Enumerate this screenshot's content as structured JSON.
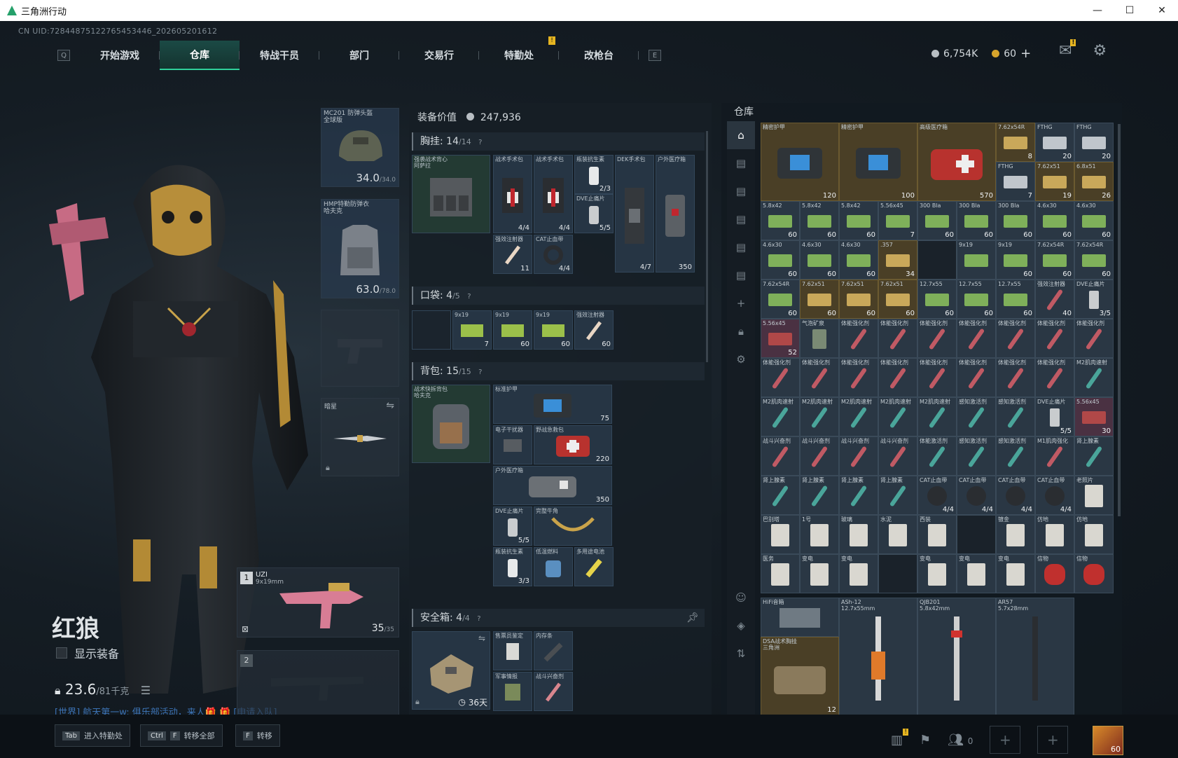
{
  "window": {
    "title": "三角洲行动",
    "minimize": "—",
    "maximize": "☐",
    "close": "✕"
  },
  "uid": "CN UID:72844875122765453446_202605201612",
  "nav": {
    "key_left": "Q",
    "key_right": "E",
    "tabs": [
      "开始游戏",
      "仓库",
      "特战干员",
      "部门",
      "交易行",
      "特勤处",
      "改枪台"
    ],
    "active": "仓库",
    "badge": "!"
  },
  "currency": {
    "silver": "6,754K",
    "gold": "60",
    "add": "+",
    "mail_badge": "!"
  },
  "operator": {
    "name": "红狼",
    "show_equipment": "显示装备",
    "weight": "23.6",
    "weight_max": "/81千克"
  },
  "chat": "[世界] 航天第一w: 俱乐部活动，来人🎁 🎁 [申请入队]",
  "slots": {
    "helmet": {
      "label": "MC201 防弹头盔\n全球版",
      "value": "34.0",
      "max": "/34.0"
    },
    "armor": {
      "label": "HMP特勤防弹衣\n哈夫克",
      "value": "63.0",
      "max": "/78.0"
    },
    "melee": {
      "label": "暗星",
      "swap": "⇋"
    },
    "weapon1": {
      "index": "1",
      "name": "UZI",
      "caliber": "9x19mm",
      "ammo": "35",
      "ammo_max": "/35"
    },
    "weapon2": {
      "index": "2"
    }
  },
  "equip": {
    "title": "装备价值",
    "value": "247,936",
    "chest": {
      "label": "胸挂:",
      "count": "14",
      "max": "/14",
      "help": "?"
    },
    "pocket": {
      "label": "口袋:",
      "count": "4",
      "max": "/5",
      "help": "?"
    },
    "backpack": {
      "label": "背包:",
      "count": "15",
      "max": "/15",
      "help": "?"
    },
    "safebox": {
      "label": "安全箱:",
      "count": "4",
      "max": "/4",
      "help": "?",
      "days": "36天"
    },
    "chest_items": [
      {
        "label": "强袭战术背心\n阿萨拉",
        "count": ""
      },
      {
        "label": "战术手术包",
        "count": "4/4"
      },
      {
        "label": "战术手术包",
        "count": "4/4"
      },
      {
        "label": "瓶装抗生素",
        "count": "2/3"
      },
      {
        "label": "DVE止痛片",
        "count": "5/5"
      },
      {
        "label": "DEK手术包",
        "count": "4/7"
      },
      {
        "label": "户外医疗箱",
        "count": "350"
      },
      {
        "label": "强效注射器",
        "count": "11"
      },
      {
        "label": "CAT止血带",
        "count": "4/4"
      }
    ],
    "pocket_items": [
      {
        "label": "9x19",
        "count": "7"
      },
      {
        "label": "9x19",
        "count": "60"
      },
      {
        "label": "9x19",
        "count": "60"
      },
      {
        "label": "强效注射器",
        "count": "60"
      }
    ],
    "backpack_items": [
      {
        "label": "战术快拆背包\n哈夫克",
        "count": ""
      },
      {
        "label": "标准护甲",
        "count": "75"
      },
      {
        "label": "电子干扰器",
        "count": ""
      },
      {
        "label": "野战急救包",
        "count": "220"
      },
      {
        "label": "户外医疗箱",
        "count": "350"
      },
      {
        "label": "DVE止痛片",
        "count": "5/5"
      },
      {
        "label": "完整牛角",
        "count": ""
      },
      {
        "label": "瓶装抗生素",
        "count": "3/3"
      },
      {
        "label": "低温燃料",
        "count": ""
      },
      {
        "label": "多用途电池",
        "count": ""
      }
    ],
    "safebox_items": [
      {
        "label": "售票员鉴定",
        "count": ""
      },
      {
        "label": "内存条",
        "count": ""
      },
      {
        "label": "军事情报",
        "count": ""
      },
      {
        "label": "战斗兴奋剂",
        "count": ""
      }
    ]
  },
  "warehouse": {
    "title": "仓库",
    "big_items": [
      {
        "label": "精密护甲",
        "count": "120"
      },
      {
        "label": "精密护甲",
        "count": "100"
      },
      {
        "label": "高级医疗箱",
        "count": "570"
      },
      {
        "label": "DSA战术胸挂\n三角洲",
        "count": "12"
      },
      {
        "label": "HiFi音箱",
        "count": ""
      },
      {
        "label": "ASh-12\n12.7x55mm",
        "count": ""
      },
      {
        "label": "QJB201\n5.8x42mm",
        "count": ""
      },
      {
        "label": "AR57\n5.7x28mm",
        "count": ""
      }
    ],
    "grid": [
      [
        null,
        null,
        null,
        null,
        null,
        null,
        {
          "l": "7.62x54R",
          "n": "8",
          "t": "gold"
        },
        {
          "l": "FTHG",
          "n": "20"
        },
        {
          "l": "FTHG",
          "n": "20"
        }
      ],
      [
        null,
        null,
        null,
        null,
        null,
        null,
        {
          "l": "FTHG",
          "n": "7"
        },
        {
          "l": "7.62x51",
          "n": "19",
          "t": "gold"
        },
        {
          "l": "6.8x51",
          "n": "26",
          "t": "gold"
        }
      ],
      [
        {
          "l": "5.8x42",
          "n": "60"
        },
        {
          "l": "5.8x42",
          "n": "60"
        },
        {
          "l": "5.8x42",
          "n": "60"
        },
        {
          "l": "5.56x45",
          "n": "7"
        },
        {
          "l": "300 Bla",
          "n": "60"
        },
        {
          "l": "300 Bla",
          "n": "60"
        },
        {
          "l": "300 Bla",
          "n": "60"
        },
        {
          "l": "4.6x30",
          "n": "60"
        },
        {
          "l": "4.6x30",
          "n": "60"
        }
      ],
      [
        {
          "l": "4.6x30",
          "n": "60"
        },
        {
          "l": "4.6x30",
          "n": "60"
        },
        {
          "l": "4.6x30",
          "n": "60"
        },
        {
          "l": ".357",
          "n": "34",
          "t": "gold"
        },
        {
          "l": "",
          "n": "",
          "t": "empty"
        },
        {
          "l": "9x19",
          "n": ""
        },
        {
          "l": "9x19",
          "n": "60"
        },
        {
          "l": "7.62x54R",
          "n": "60"
        },
        {
          "l": "7.62x54R",
          "n": "60"
        }
      ],
      [
        {
          "l": "7.62x54R",
          "n": "60"
        },
        {
          "l": "7.62x51",
          "n": "60",
          "t": "gold"
        },
        {
          "l": "7.62x51",
          "n": "60",
          "t": "gold"
        },
        {
          "l": "7.62x51",
          "n": "60",
          "t": "gold"
        },
        {
          "l": "12.7x55",
          "n": "60"
        },
        {
          "l": "12.7x55",
          "n": "60"
        },
        {
          "l": "12.7x55",
          "n": "60"
        },
        {
          "l": "强效注射器",
          "n": "40"
        },
        {
          "l": "DVE止痛片",
          "n": "3/5"
        }
      ],
      [
        {
          "l": "5.56x45",
          "n": "52",
          "t": "pink"
        },
        {
          "l": "气泡矿泉",
          "n": ""
        },
        {
          "l": "体能强化剂",
          "n": ""
        },
        {
          "l": "体能强化剂",
          "n": ""
        },
        {
          "l": "体能强化剂",
          "n": ""
        },
        {
          "l": "体能强化剂",
          "n": ""
        },
        {
          "l": "体能强化剂",
          "n": ""
        },
        {
          "l": "体能强化剂",
          "n": ""
        },
        {
          "l": "体能强化剂",
          "n": ""
        }
      ],
      [
        {
          "l": "体能强化剂",
          "n": ""
        },
        {
          "l": "体能强化剂",
          "n": ""
        },
        {
          "l": "体能强化剂",
          "n": ""
        },
        {
          "l": "体能强化剂",
          "n": ""
        },
        {
          "l": "体能强化剂",
          "n": ""
        },
        {
          "l": "体能强化剂",
          "n": ""
        },
        {
          "l": "体能强化剂",
          "n": ""
        },
        {
          "l": "体能强化剂",
          "n": ""
        },
        {
          "l": "M2肌肉速射",
          "n": ""
        }
      ],
      [
        {
          "l": "M2肌肉速射",
          "n": ""
        },
        {
          "l": "M2肌肉速射",
          "n": ""
        },
        {
          "l": "M2肌肉速射",
          "n": ""
        },
        {
          "l": "M2肌肉速射",
          "n": ""
        },
        {
          "l": "M2肌肉速射",
          "n": ""
        },
        {
          "l": "感知激活剂",
          "n": ""
        },
        {
          "l": "感知激活剂",
          "n": ""
        },
        {
          "l": "DVE止痛片",
          "n": "5/5"
        },
        {
          "l": "5.56x45",
          "n": "30",
          "t": "pink"
        }
      ],
      [
        {
          "l": "战斗兴奋剂",
          "n": ""
        },
        {
          "l": "战斗兴奋剂",
          "n": ""
        },
        {
          "l": "战斗兴奋剂",
          "n": ""
        },
        {
          "l": "战斗兴奋剂",
          "n": ""
        },
        {
          "l": "体能激活剂",
          "n": ""
        },
        {
          "l": "感知激活剂",
          "n": ""
        },
        {
          "l": "感知激活剂",
          "n": ""
        },
        {
          "l": "M1肌肉强化",
          "n": ""
        },
        {
          "l": "肾上腺素",
          "n": ""
        }
      ],
      [
        {
          "l": "肾上腺素",
          "n": ""
        },
        {
          "l": "肾上腺素",
          "n": ""
        },
        {
          "l": "肾上腺素",
          "n": ""
        },
        {
          "l": "肾上腺素",
          "n": ""
        },
        {
          "l": "CAT止血带",
          "n": "4/4"
        },
        {
          "l": "CAT止血带",
          "n": "4/4"
        },
        {
          "l": "CAT止血带",
          "n": "4/4"
        },
        {
          "l": "CAT止血带",
          "n": "4/4"
        },
        {
          "l": "老照片",
          "n": ""
        }
      ],
      [
        {
          "l": "巴别塔",
          "n": ""
        },
        {
          "l": "1号",
          "n": ""
        },
        {
          "l": "玻璃",
          "n": ""
        },
        {
          "l": "水泥",
          "n": ""
        },
        {
          "l": "西装",
          "n": ""
        },
        {
          "l": "",
          "n": "",
          "t": "empty"
        },
        {
          "l": "镀金",
          "n": ""
        },
        {
          "l": "仿地",
          "n": ""
        },
        {
          "l": "仿地",
          "n": ""
        }
      ],
      [
        {
          "l": "医务",
          "n": ""
        },
        {
          "l": "变电",
          "n": ""
        },
        {
          "l": "变电",
          "n": ""
        },
        {
          "l": "",
          "n": "",
          "t": "empty"
        },
        {
          "l": "变电",
          "n": ""
        },
        {
          "l": "变电",
          "n": ""
        },
        {
          "l": "变电",
          "n": ""
        },
        {
          "l": "信物",
          "n": ""
        },
        {
          "l": "信物",
          "n": ""
        }
      ]
    ]
  },
  "bottom": {
    "k1": {
      "key": "Tab",
      "label": "进入特勤处"
    },
    "k2": {
      "key": "Ctrl",
      "key2": "F",
      "label": "转移全部"
    },
    "k3": {
      "key": "F",
      "label": "转移"
    },
    "badge": "!",
    "squad": "0",
    "level": "60"
  },
  "colors": {
    "accent": "#2fd09a",
    "gold": "#d6a42c",
    "badge": "#e6b521"
  }
}
